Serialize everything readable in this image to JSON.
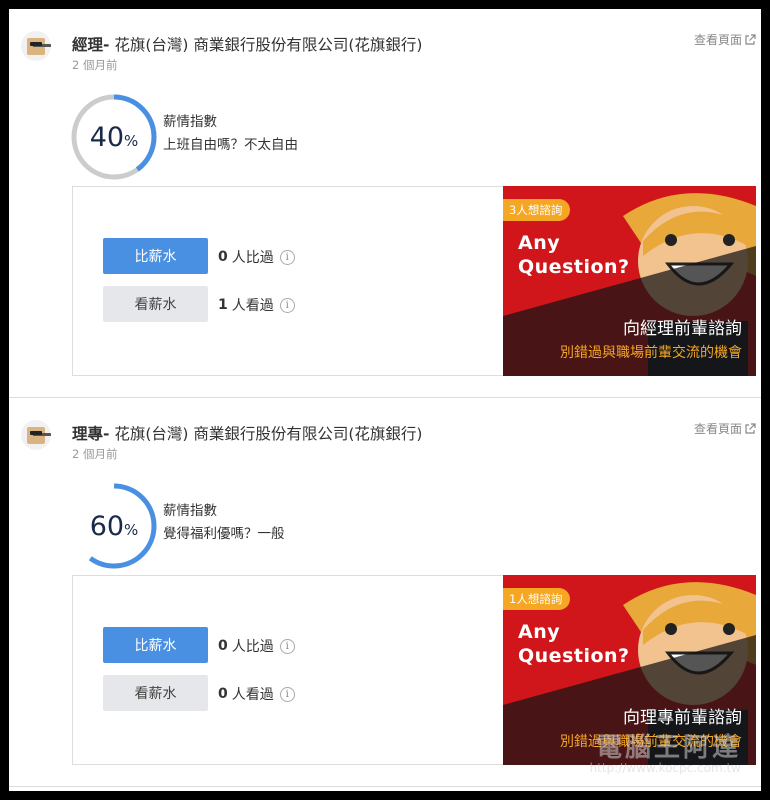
{
  "posts": [
    {
      "role": "經理-",
      "company": " 花旗(台灣) 商業銀行股份有限公司(花旗銀行)",
      "time": "2 個月前",
      "view_link": "查看頁面",
      "gauge_value": "40",
      "gauge_unit": "%",
      "gauge_fraction": 0.4,
      "index_label": "薪情指數",
      "index_answer": "上班自由嗎？不太自由",
      "compare_button": "比薪水",
      "view_button": "看薪水",
      "compare_count": "0",
      "compare_count_text": "人比過",
      "view_count": "1",
      "view_count_text": "人看過",
      "banner": {
        "badge": "3人想諮詢",
        "any": "Any",
        "question": "Question?",
        "cta": "向經理前輩諮詢",
        "sub": "別錯過與職場前輩交流的機會"
      }
    },
    {
      "role": "理專-",
      "company": " 花旗(台灣) 商業銀行股份有限公司(花旗銀行)",
      "time": "2 個月前",
      "view_link": "查看頁面",
      "gauge_value": "60",
      "gauge_unit": "%",
      "gauge_fraction": 0.6,
      "index_label": "薪情指數",
      "index_answer": "覺得福利優嗎？一般",
      "compare_button": "比薪水",
      "view_button": "看薪水",
      "compare_count": "0",
      "compare_count_text": "人比過",
      "view_count": "0",
      "view_count_text": "人看過",
      "banner": {
        "badge": "1人想諮詢",
        "any": "Any",
        "question": "Question?",
        "cta": "向理專前輩諮詢",
        "sub": "別錯過與職場前輩交流的機會"
      }
    }
  ],
  "info_glyph": "i",
  "watermark": {
    "text": "電腦王阿達",
    "url": "http://www.kocpc.com.tw"
  },
  "colors": {
    "gauge_active": "#4a90e2",
    "gauge_track": "#cccccc",
    "compare_button": "#4a90e2",
    "banner_red": "#d0161b",
    "badge": "#f5a623"
  }
}
